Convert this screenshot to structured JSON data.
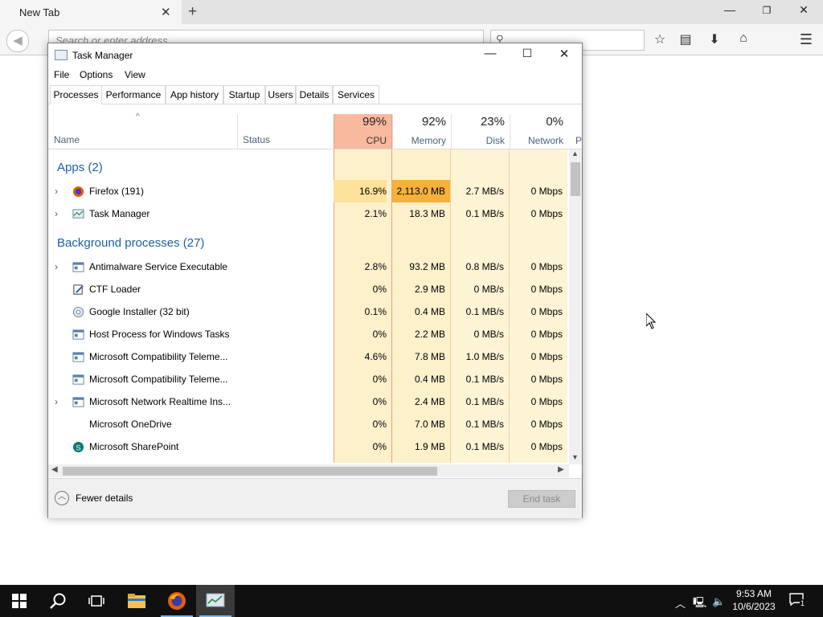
{
  "browser": {
    "tab_title": "New Tab",
    "address_placeholder": "Search or enter address"
  },
  "task_manager": {
    "title": "Task Manager",
    "menu": [
      "File",
      "Options",
      "View"
    ],
    "tabs": [
      "Processes",
      "Performance",
      "App history",
      "Startup",
      "Users",
      "Details",
      "Services"
    ],
    "active_tab": "Processes",
    "columns": {
      "name": "Name",
      "status": "Status",
      "cpu": {
        "pct": "99%",
        "label": "CPU"
      },
      "memory": {
        "pct": "92%",
        "label": "Memory"
      },
      "disk": {
        "pct": "23%",
        "label": "Disk"
      },
      "network": {
        "pct": "0%",
        "label": "Network"
      },
      "next": "P"
    },
    "groups": {
      "apps": "Apps (2)",
      "background": "Background processes (27)"
    },
    "rows": [
      {
        "name": "Firefox (191)",
        "cpu": "16.9%",
        "memory": "2,113.0 MB",
        "disk": "2.7 MB/s",
        "network": "0 Mbps"
      },
      {
        "name": "Task Manager",
        "cpu": "2.1%",
        "memory": "18.3 MB",
        "disk": "0.1 MB/s",
        "network": "0 Mbps"
      },
      {
        "name": "Antimalware Service Executable",
        "cpu": "2.8%",
        "memory": "93.2 MB",
        "disk": "0.8 MB/s",
        "network": "0 Mbps"
      },
      {
        "name": "CTF Loader",
        "cpu": "0%",
        "memory": "2.9 MB",
        "disk": "0 MB/s",
        "network": "0 Mbps"
      },
      {
        "name": "Google Installer (32 bit)",
        "cpu": "0.1%",
        "memory": "0.4 MB",
        "disk": "0.1 MB/s",
        "network": "0 Mbps"
      },
      {
        "name": "Host Process for Windows Tasks",
        "cpu": "0%",
        "memory": "2.2 MB",
        "disk": "0 MB/s",
        "network": "0 Mbps"
      },
      {
        "name": "Microsoft Compatibility Teleme...",
        "cpu": "4.6%",
        "memory": "7.8 MB",
        "disk": "1.0 MB/s",
        "network": "0 Mbps"
      },
      {
        "name": "Microsoft Compatibility Teleme...",
        "cpu": "0%",
        "memory": "0.4 MB",
        "disk": "0.1 MB/s",
        "network": "0 Mbps"
      },
      {
        "name": "Microsoft Network Realtime Ins...",
        "cpu": "0%",
        "memory": "2.4 MB",
        "disk": "0.1 MB/s",
        "network": "0 Mbps"
      },
      {
        "name": "Microsoft OneDrive",
        "cpu": "0%",
        "memory": "7.0 MB",
        "disk": "0.1 MB/s",
        "network": "0 Mbps"
      },
      {
        "name": "Microsoft SharePoint",
        "cpu": "0%",
        "memory": "1.9 MB",
        "disk": "0.1 MB/s",
        "network": "0 Mbps"
      }
    ],
    "fewer_details": "Fewer details",
    "end_task": "End task"
  },
  "taskbar": {
    "time": "9:53 AM",
    "date": "10/6/2023",
    "notification_count": "1"
  }
}
